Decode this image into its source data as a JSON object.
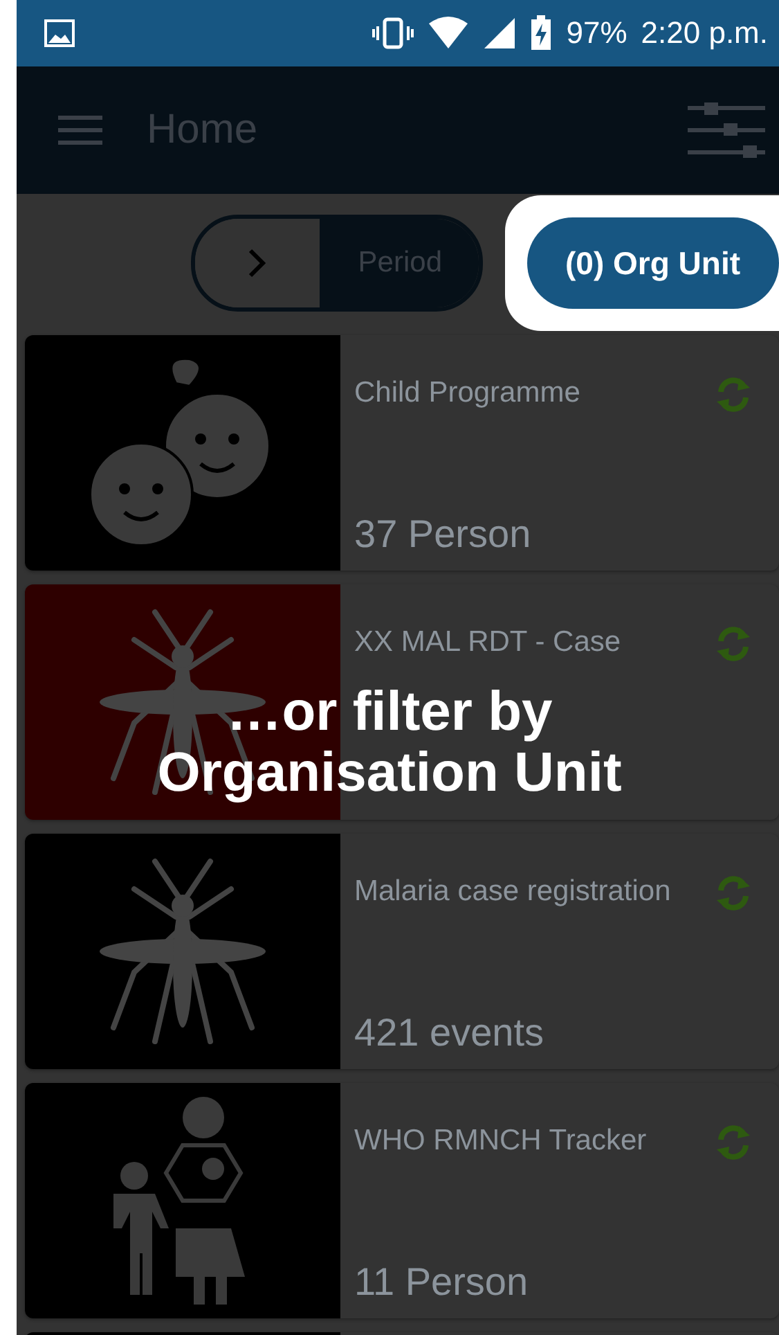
{
  "status_bar": {
    "battery": "97%",
    "time": "2:20 p.m."
  },
  "toolbar": {
    "title": "Home"
  },
  "filters": [
    {
      "label": "Period",
      "highlighted": false
    },
    {
      "label": "(0) Org Unit",
      "highlighted": true
    }
  ],
  "programs": [
    {
      "kind": "children",
      "color": "#000000",
      "title": "Child Programme",
      "count": "37 Person"
    },
    {
      "kind": "mosquito",
      "color": "#2e0000",
      "title": "XX MAL RDT - Case"
    },
    {
      "kind": "mosquito",
      "color": "#000000",
      "title": "Malaria case registration",
      "count": "421 events"
    },
    {
      "kind": "family",
      "color": "#000000",
      "title": "WHO RMNCH Tracker",
      "count": "11 Person"
    }
  ],
  "overlay": {
    "lines": [
      "…or filter by",
      "Organisation Unit"
    ]
  }
}
